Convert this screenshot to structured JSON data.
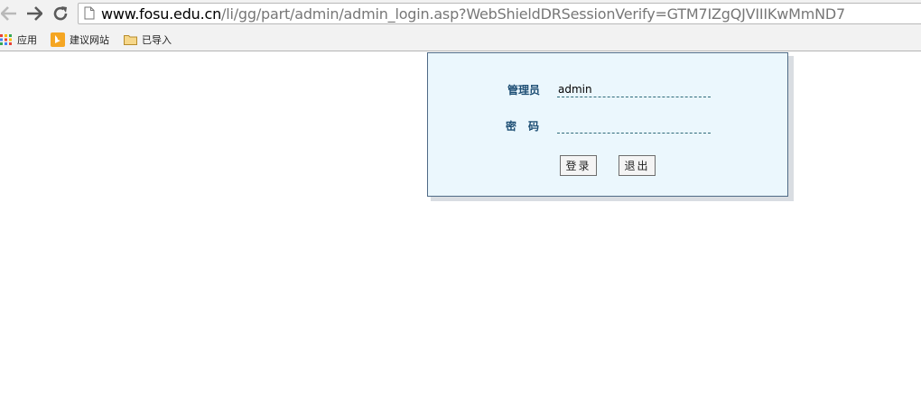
{
  "browser": {
    "url_host": "www.fosu.edu.cn",
    "url_path": "/li/gg/part/admin/admin_login.asp?WebShieldDRSessionVerify=GTM7IZgQJVIIIKwMmND7",
    "nav_icons": [
      "back-arrow-icon",
      "forward-arrow-icon",
      "reload-icon",
      "page-icon"
    ]
  },
  "bookmarks": {
    "items": [
      {
        "label": "应用",
        "icon": "apps-grid-icon"
      },
      {
        "label": "建议网站",
        "icon": "bing-icon"
      },
      {
        "label": "已导入",
        "icon": "folder-icon"
      }
    ]
  },
  "login": {
    "username_label": "管理员",
    "username_value": "admin",
    "password_label": "密码",
    "password_value": "",
    "login_button": "登录",
    "exit_button": "退出"
  },
  "colors": {
    "panel_bg": "#ebf7fd",
    "panel_border": "#4f6a86",
    "label_color": "#1d4e74"
  }
}
